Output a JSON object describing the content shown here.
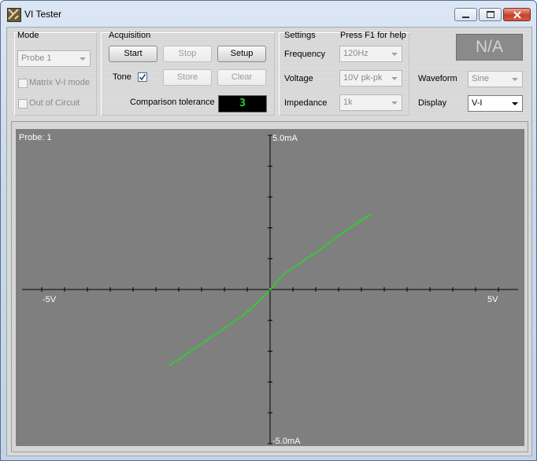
{
  "window": {
    "title": "VI Tester"
  },
  "mode": {
    "heading": "Mode",
    "probe_value": "Probe 1",
    "matrix_label": "Matrix V-I mode",
    "out_of_circuit_label": "Out of Circuit"
  },
  "acquisition": {
    "heading": "Acquisition",
    "start_label": "Start",
    "stop_label": "Stop",
    "setup_label": "Setup",
    "tone_label": "Tone",
    "tone_checked": true,
    "store_label": "Store",
    "clear_label": "Clear",
    "tolerance_label": "Comparison tolerance",
    "tolerance_value": "3"
  },
  "settings": {
    "heading": "Settings",
    "help_text": "Press F1 for help",
    "frequency_label": "Frequency",
    "frequency_value": "120Hz",
    "voltage_label": "Voltage",
    "voltage_value": "10V pk-pk",
    "impedance_label": "Impedance",
    "impedance_value": "1k",
    "waveform_label": "Waveform",
    "waveform_value": "Sine",
    "display_label": "Display",
    "display_value": "V-I",
    "status_value": "N/A"
  },
  "plot": {
    "probe_label": "Probe: 1",
    "y_top_label": "5.0mA",
    "y_bottom_label": "-5.0mA",
    "x_left_label": "-5V",
    "x_right_label": "5V",
    "trace_color": "#22dd22",
    "background_color": "#7f7f7f"
  },
  "chart_data": {
    "type": "line",
    "xlabel": "",
    "ylabel": "",
    "xlim": [
      -5,
      5
    ],
    "ylim": [
      -5,
      5
    ],
    "series": [
      {
        "x": [
          -2.2,
          -1.8,
          -1.4,
          -1.0,
          -0.6,
          -0.3,
          0.0,
          0.3,
          0.7,
          1.1,
          1.5,
          1.9,
          2.2
        ],
        "y": [
          -2.45,
          -2.05,
          -1.65,
          -1.25,
          -0.85,
          -0.45,
          0.0,
          0.5,
          0.9,
          1.3,
          1.75,
          2.15,
          2.45
        ]
      }
    ]
  }
}
